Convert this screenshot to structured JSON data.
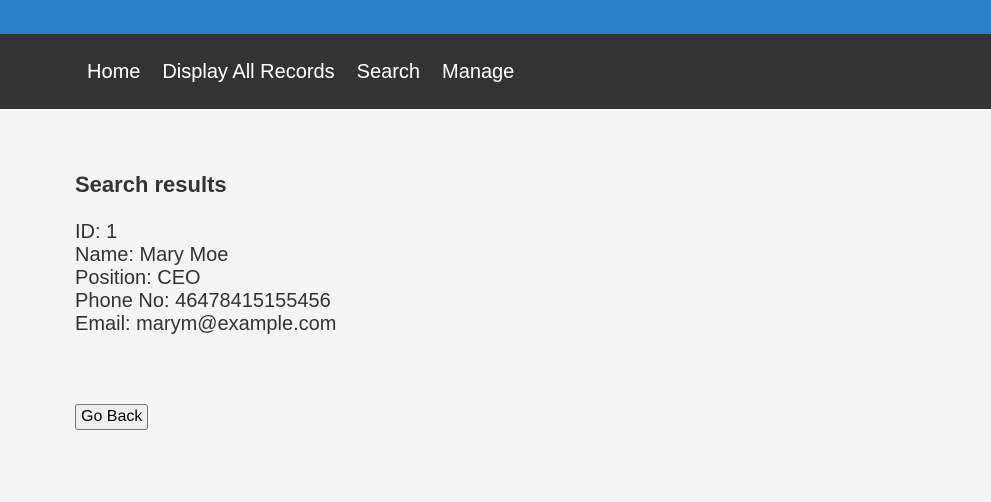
{
  "nav": {
    "items": [
      {
        "label": "Home"
      },
      {
        "label": "Display All Records"
      },
      {
        "label": "Search"
      },
      {
        "label": "Manage"
      }
    ]
  },
  "main": {
    "heading": "Search results",
    "record": {
      "id": "ID: 1",
      "name": "Name: Mary Moe",
      "position": "Position: CEO",
      "phone": "Phone No: 46478415155456",
      "email": "Email: marym@example.com"
    },
    "go_back_label": "Go Back"
  },
  "colors": {
    "top_accent": "#2e80c9",
    "navbar_bg": "#333333",
    "page_bg": "#f5f5f5"
  }
}
